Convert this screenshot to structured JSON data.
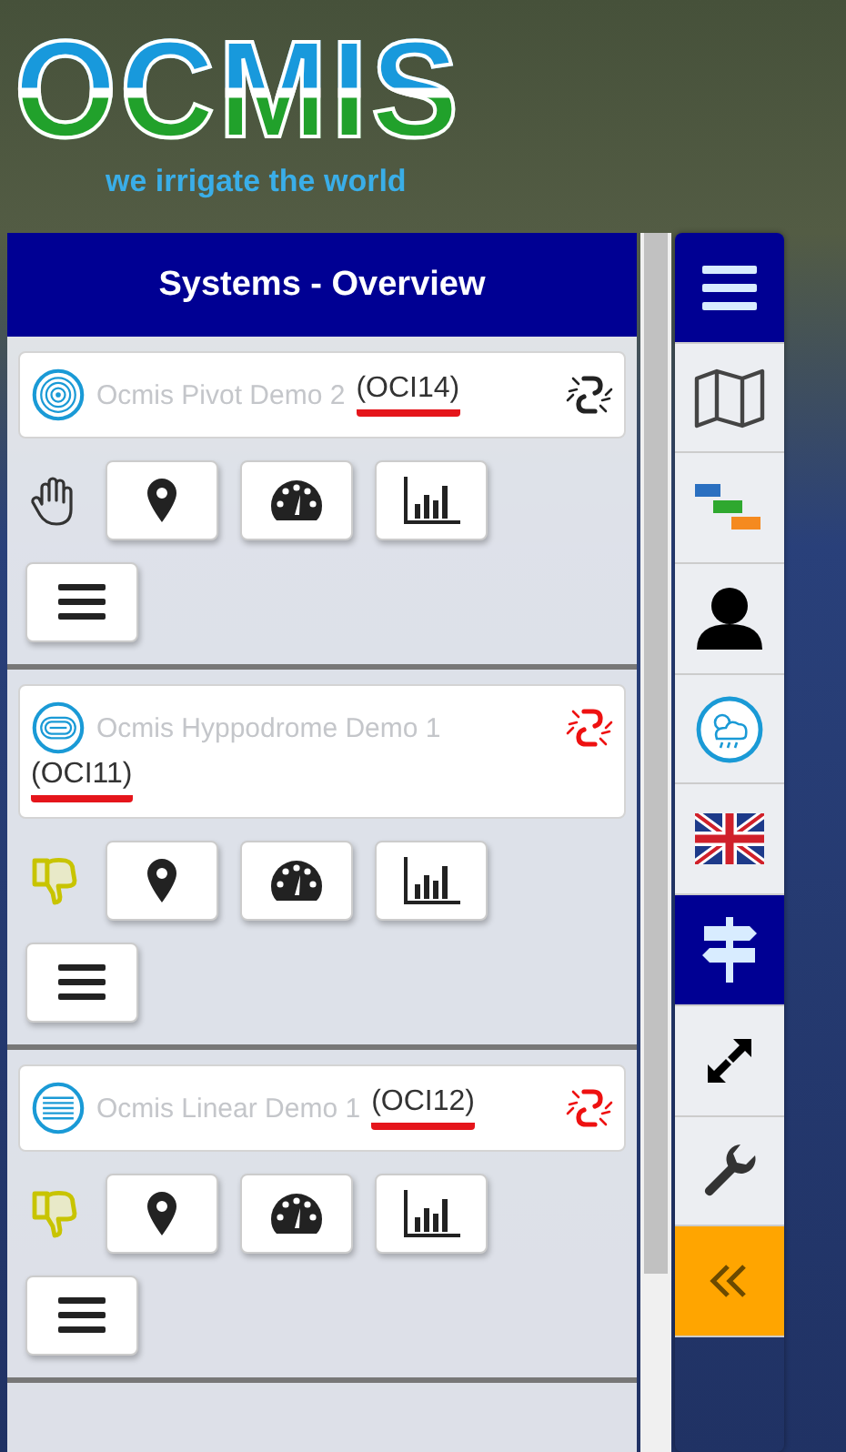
{
  "logo": {
    "title": "OCMIS",
    "tagline": "we irrigate the world"
  },
  "panel": {
    "title": "Systems - Overview"
  },
  "systems": [
    {
      "kind": "pivot",
      "name": "Ocmis Pivot Demo 2",
      "code": "(OCI14)",
      "code_highlighted": true,
      "status": {
        "kind": "manual"
      },
      "link": {
        "color": "#222222"
      }
    },
    {
      "kind": "hippodrome",
      "name": "Ocmis Hyppodrome Demo 1",
      "code": "(OCI11)",
      "code_highlighted": true,
      "status": {
        "kind": "fault"
      },
      "link": {
        "color": "#ee1111"
      }
    },
    {
      "kind": "linear",
      "name": "Ocmis Linear Demo 1",
      "code": "(OCI12)",
      "code_highlighted": true,
      "status": {
        "kind": "fault"
      },
      "link": {
        "color": "#ee1111"
      }
    }
  ],
  "sidebar": {
    "items": [
      {
        "kind": "menu",
        "selected": true
      },
      {
        "kind": "map",
        "selected": false
      },
      {
        "kind": "tasks",
        "selected": false
      },
      {
        "kind": "user",
        "selected": false
      },
      {
        "kind": "weather",
        "selected": false
      },
      {
        "kind": "language",
        "selected": false
      },
      {
        "kind": "signpost",
        "selected": true
      },
      {
        "kind": "fullscreen",
        "selected": false
      },
      {
        "kind": "wrench",
        "selected": false
      },
      {
        "kind": "collapse",
        "selected": false
      }
    ]
  }
}
